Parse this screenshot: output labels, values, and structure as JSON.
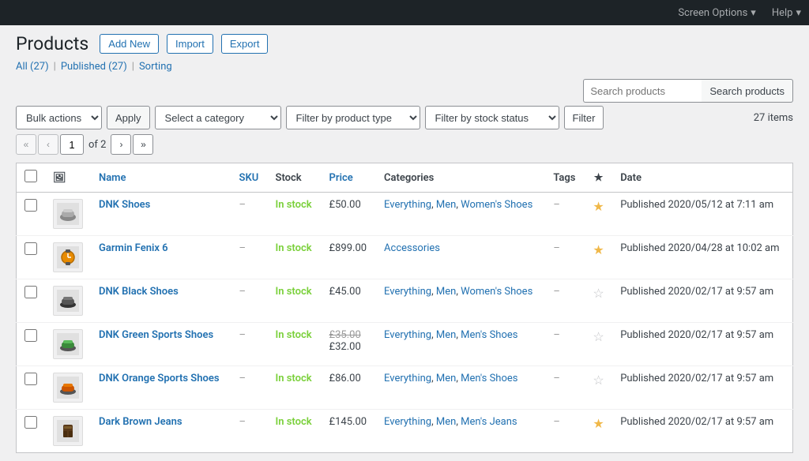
{
  "topbar": {
    "screen_options": "Screen Options",
    "help": "Help"
  },
  "header": {
    "title": "Products",
    "add_new": "Add New",
    "import": "Import",
    "export": "Export"
  },
  "sublinks": {
    "all": "All",
    "all_count": "(27)",
    "published": "Published",
    "published_count": "(27)",
    "sorting": "Sorting"
  },
  "toolbar": {
    "bulk_actions": "Bulk actions",
    "apply": "Apply",
    "select_category": "Select a category",
    "filter_product_type": "Filter by product type",
    "filter_stock_status": "Filter by stock status",
    "filter": "Filter",
    "items_count": "27 items",
    "page_current": "1",
    "page_total": "2",
    "search_placeholder": "Search products",
    "search_btn": "Search products"
  },
  "table": {
    "headers": {
      "name": "Name",
      "sku": "SKU",
      "stock": "Stock",
      "price": "Price",
      "categories": "Categories",
      "tags": "Tags",
      "date": "Date"
    },
    "rows": [
      {
        "name": "DNK Shoes",
        "sku": "–",
        "stock": "In stock",
        "price": "£50.00",
        "price_original": "",
        "categories": "Everything, Men, Women's Shoes",
        "tags": "–",
        "starred": true,
        "date": "Published 2020/05/12 at 7:11 am"
      },
      {
        "name": "Garmin Fenix 6",
        "sku": "–",
        "stock": "In stock",
        "price": "£899.00",
        "price_original": "",
        "categories": "Accessories",
        "tags": "–",
        "starred": true,
        "date": "Published 2020/04/28 at 10:02 am"
      },
      {
        "name": "DNK Black Shoes",
        "sku": "–",
        "stock": "In stock",
        "price": "£45.00",
        "price_original": "",
        "categories": "Everything, Men, Women's Shoes",
        "tags": "–",
        "starred": false,
        "date": "Published 2020/02/17 at 9:57 am"
      },
      {
        "name": "DNK Green Sports Shoes",
        "sku": "–",
        "stock": "In stock",
        "price": "£32.00",
        "price_original": "£35.00",
        "categories": "Everything, Men, Men's Shoes",
        "tags": "–",
        "starred": false,
        "date": "Published 2020/02/17 at 9:57 am"
      },
      {
        "name": "DNK Orange Sports Shoes",
        "sku": "–",
        "stock": "In stock",
        "price": "£86.00",
        "price_original": "",
        "categories": "Everything, Men, Men's Shoes",
        "tags": "–",
        "starred": false,
        "date": "Published 2020/02/17 at 9:57 am"
      },
      {
        "name": "Dark Brown Jeans",
        "sku": "–",
        "stock": "In stock",
        "price": "£145.00",
        "price_original": "",
        "categories": "Everything, Men, Men's Jeans",
        "tags": "–",
        "starred": true,
        "date": "Published 2020/02/17 at 9:57 am"
      }
    ]
  },
  "colors": {
    "accent": "#2271b1",
    "in_stock": "#7ad03a",
    "star_filled": "#f0b849"
  }
}
